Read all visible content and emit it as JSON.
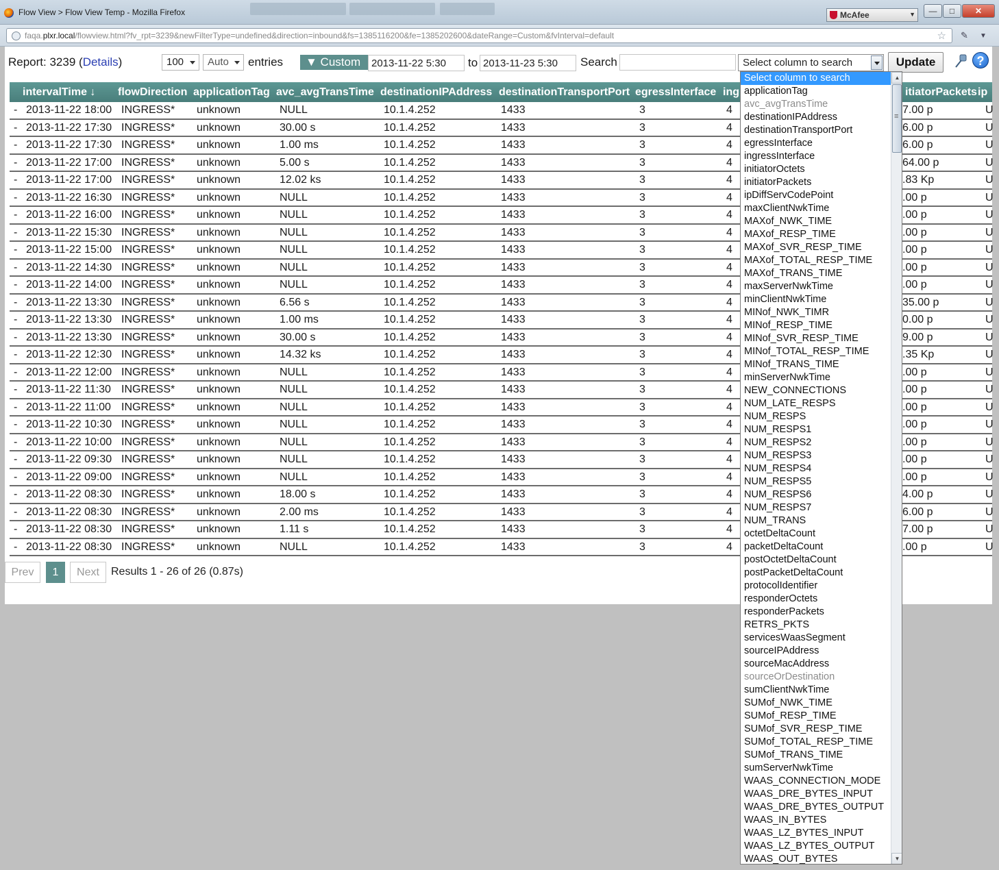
{
  "window": {
    "title": "Flow View > Flow View Temp - Mozilla Firefox",
    "mcafee_label": "McAfee",
    "url_prefix": "faqa.",
    "url_host": "plxr.local",
    "url_rest": "/flowview.html?fv_rpt=3239&newFilterType=undefined&direction=inbound&fs=1385116200&fe=1385202600&dateRange=Custom&fvInterval=default"
  },
  "toolbar": {
    "report_label": "Report: 3239 (",
    "details_link": "Details",
    "report_close": ")",
    "entries_count": "100",
    "interval": "Auto",
    "entries_label": "entries",
    "custom_label": "▼ Custom",
    "date_from": "2013-11-22 5:30",
    "to_label": "to",
    "date_to": "2013-11-23 5:30",
    "search_label": "Search",
    "search_value": "",
    "column_select": "Select column to search",
    "update_label": "Update",
    "help_label": "?"
  },
  "table": {
    "headers": [
      "intervalTime ↓",
      "flowDirection",
      "applicationTag",
      "avc_avgTransTime",
      "destinationIPAddress",
      "destinationTransportPort",
      "egressInterface",
      "ing",
      "itiatorPackets",
      "ip"
    ],
    "rows": [
      [
        "-",
        "2013-11-22 18:00",
        "INGRESS*",
        "unknown",
        "NULL",
        "10.1.4.252",
        "1433",
        "3",
        "4",
        "7.00 p",
        "U"
      ],
      [
        "-",
        "2013-11-22 17:30",
        "INGRESS*",
        "unknown",
        "30.00 s",
        "10.1.4.252",
        "1433",
        "3",
        "4",
        "6.00 p",
        "U"
      ],
      [
        "-",
        "2013-11-22 17:30",
        "INGRESS*",
        "unknown",
        "1.00 ms",
        "10.1.4.252",
        "1433",
        "3",
        "4",
        "6.00 p",
        "U"
      ],
      [
        "-",
        "2013-11-22 17:00",
        "INGRESS*",
        "unknown",
        "5.00 s",
        "10.1.4.252",
        "1433",
        "3",
        "4",
        "64.00 p",
        "U"
      ],
      [
        "-",
        "2013-11-22 17:00",
        "INGRESS*",
        "unknown",
        "12.02 ks",
        "10.1.4.252",
        "1433",
        "3",
        "4",
        ".83 Kp",
        "U"
      ],
      [
        "-",
        "2013-11-22 16:30",
        "INGRESS*",
        "unknown",
        "NULL",
        "10.1.4.252",
        "1433",
        "3",
        "4",
        ".00 p",
        "U"
      ],
      [
        "-",
        "2013-11-22 16:00",
        "INGRESS*",
        "unknown",
        "NULL",
        "10.1.4.252",
        "1433",
        "3",
        "4",
        ".00 p",
        "U"
      ],
      [
        "-",
        "2013-11-22 15:30",
        "INGRESS*",
        "unknown",
        "NULL",
        "10.1.4.252",
        "1433",
        "3",
        "4",
        ".00 p",
        "U"
      ],
      [
        "-",
        "2013-11-22 15:00",
        "INGRESS*",
        "unknown",
        "NULL",
        "10.1.4.252",
        "1433",
        "3",
        "4",
        ".00 p",
        "U"
      ],
      [
        "-",
        "2013-11-22 14:30",
        "INGRESS*",
        "unknown",
        "NULL",
        "10.1.4.252",
        "1433",
        "3",
        "4",
        ".00 p",
        "U"
      ],
      [
        "-",
        "2013-11-22 14:00",
        "INGRESS*",
        "unknown",
        "NULL",
        "10.1.4.252",
        "1433",
        "3",
        "4",
        ".00 p",
        "U"
      ],
      [
        "-",
        "2013-11-22 13:30",
        "INGRESS*",
        "unknown",
        "6.56 s",
        "10.1.4.252",
        "1433",
        "3",
        "4",
        "35.00 p",
        "U"
      ],
      [
        "-",
        "2013-11-22 13:30",
        "INGRESS*",
        "unknown",
        "1.00 ms",
        "10.1.4.252",
        "1433",
        "3",
        "4",
        "0.00 p",
        "U"
      ],
      [
        "-",
        "2013-11-22 13:30",
        "INGRESS*",
        "unknown",
        "30.00 s",
        "10.1.4.252",
        "1433",
        "3",
        "4",
        "9.00 p",
        "U"
      ],
      [
        "-",
        "2013-11-22 12:30",
        "INGRESS*",
        "unknown",
        "14.32 ks",
        "10.1.4.252",
        "1433",
        "3",
        "4",
        ".35 Kp",
        "U"
      ],
      [
        "-",
        "2013-11-22 12:00",
        "INGRESS*",
        "unknown",
        "NULL",
        "10.1.4.252",
        "1433",
        "3",
        "4",
        ".00 p",
        "U"
      ],
      [
        "-",
        "2013-11-22 11:30",
        "INGRESS*",
        "unknown",
        "NULL",
        "10.1.4.252",
        "1433",
        "3",
        "4",
        ".00 p",
        "U"
      ],
      [
        "-",
        "2013-11-22 11:00",
        "INGRESS*",
        "unknown",
        "NULL",
        "10.1.4.252",
        "1433",
        "3",
        "4",
        ".00 p",
        "U"
      ],
      [
        "-",
        "2013-11-22 10:30",
        "INGRESS*",
        "unknown",
        "NULL",
        "10.1.4.252",
        "1433",
        "3",
        "4",
        ".00 p",
        "U"
      ],
      [
        "-",
        "2013-11-22 10:00",
        "INGRESS*",
        "unknown",
        "NULL",
        "10.1.4.252",
        "1433",
        "3",
        "4",
        ".00 p",
        "U"
      ],
      [
        "-",
        "2013-11-22 09:30",
        "INGRESS*",
        "unknown",
        "NULL",
        "10.1.4.252",
        "1433",
        "3",
        "4",
        ".00 p",
        "U"
      ],
      [
        "-",
        "2013-11-22 09:00",
        "INGRESS*",
        "unknown",
        "NULL",
        "10.1.4.252",
        "1433",
        "3",
        "4",
        ".00 p",
        "U"
      ],
      [
        "-",
        "2013-11-22 08:30",
        "INGRESS*",
        "unknown",
        "18.00 s",
        "10.1.4.252",
        "1433",
        "3",
        "4",
        "4.00 p",
        "U"
      ],
      [
        "-",
        "2013-11-22 08:30",
        "INGRESS*",
        "unknown",
        "2.00 ms",
        "10.1.4.252",
        "1433",
        "3",
        "4",
        "6.00 p",
        "U"
      ],
      [
        "-",
        "2013-11-22 08:30",
        "INGRESS*",
        "unknown",
        "1.11 s",
        "10.1.4.252",
        "1433",
        "3",
        "4",
        "7.00 p",
        "U"
      ],
      [
        "-",
        "2013-11-22 08:30",
        "INGRESS*",
        "unknown",
        "NULL",
        "10.1.4.252",
        "1433",
        "3",
        "4",
        ".00 p",
        "U"
      ]
    ]
  },
  "pagination": {
    "prev": "Prev",
    "current": "1",
    "next": "Next",
    "results": "Results 1 - 26 of 26 (0.87s)"
  },
  "column_dropdown": {
    "options": [
      {
        "label": "Select column to search",
        "state": "selected"
      },
      {
        "label": "applicationTag",
        "state": "normal"
      },
      {
        "label": "avc_avgTransTime",
        "state": "disabled"
      },
      {
        "label": "destinationIPAddress",
        "state": "normal"
      },
      {
        "label": "destinationTransportPort",
        "state": "normal"
      },
      {
        "label": "egressInterface",
        "state": "normal"
      },
      {
        "label": "ingressInterface",
        "state": "normal"
      },
      {
        "label": "initiatorOctets",
        "state": "normal"
      },
      {
        "label": "initiatorPackets",
        "state": "normal"
      },
      {
        "label": "ipDiffServCodePoint",
        "state": "normal"
      },
      {
        "label": "maxClientNwkTime",
        "state": "normal"
      },
      {
        "label": "MAXof_NWK_TIME",
        "state": "normal"
      },
      {
        "label": "MAXof_RESP_TIME",
        "state": "normal"
      },
      {
        "label": "MAXof_SVR_RESP_TIME",
        "state": "normal"
      },
      {
        "label": "MAXof_TOTAL_RESP_TIME",
        "state": "normal"
      },
      {
        "label": "MAXof_TRANS_TIME",
        "state": "normal"
      },
      {
        "label": "maxServerNwkTime",
        "state": "normal"
      },
      {
        "label": "minClientNwkTime",
        "state": "normal"
      },
      {
        "label": "MINof_NWK_TIMR",
        "state": "normal"
      },
      {
        "label": "MINof_RESP_TIME",
        "state": "normal"
      },
      {
        "label": "MINof_SVR_RESP_TIME",
        "state": "normal"
      },
      {
        "label": "MINof_TOTAL_RESP_TIME",
        "state": "normal"
      },
      {
        "label": "MINof_TRANS_TIME",
        "state": "normal"
      },
      {
        "label": "minServerNwkTime",
        "state": "normal"
      },
      {
        "label": "NEW_CONNECTIONS",
        "state": "normal"
      },
      {
        "label": "NUM_LATE_RESPS",
        "state": "normal"
      },
      {
        "label": "NUM_RESPS",
        "state": "normal"
      },
      {
        "label": "NUM_RESPS1",
        "state": "normal"
      },
      {
        "label": "NUM_RESPS2",
        "state": "normal"
      },
      {
        "label": "NUM_RESPS3",
        "state": "normal"
      },
      {
        "label": "NUM_RESPS4",
        "state": "normal"
      },
      {
        "label": "NUM_RESPS5",
        "state": "normal"
      },
      {
        "label": "NUM_RESPS6",
        "state": "normal"
      },
      {
        "label": "NUM_RESPS7",
        "state": "normal"
      },
      {
        "label": "NUM_TRANS",
        "state": "normal"
      },
      {
        "label": "octetDeltaCount",
        "state": "normal"
      },
      {
        "label": "packetDeltaCount",
        "state": "normal"
      },
      {
        "label": "postOctetDeltaCount",
        "state": "normal"
      },
      {
        "label": "postPacketDeltaCount",
        "state": "normal"
      },
      {
        "label": "protocolIdentifier",
        "state": "normal"
      },
      {
        "label": "responderOctets",
        "state": "normal"
      },
      {
        "label": "responderPackets",
        "state": "normal"
      },
      {
        "label": "RETRS_PKTS",
        "state": "normal"
      },
      {
        "label": "servicesWaasSegment",
        "state": "normal"
      },
      {
        "label": "sourceIPAddress",
        "state": "normal"
      },
      {
        "label": "sourceMacAddress",
        "state": "normal"
      },
      {
        "label": "sourceOrDestination",
        "state": "disabled"
      },
      {
        "label": "sumClientNwkTime",
        "state": "normal"
      },
      {
        "label": "SUMof_NWK_TIME",
        "state": "normal"
      },
      {
        "label": "SUMof_RESP_TIME",
        "state": "normal"
      },
      {
        "label": "SUMof_SVR_RESP_TIME",
        "state": "normal"
      },
      {
        "label": "SUMof_TOTAL_RESP_TIME",
        "state": "normal"
      },
      {
        "label": "SUMof_TRANS_TIME",
        "state": "normal"
      },
      {
        "label": "sumServerNwkTime",
        "state": "normal"
      },
      {
        "label": "WAAS_CONNECTION_MODE",
        "state": "normal"
      },
      {
        "label": "WAAS_DRE_BYTES_INPUT",
        "state": "normal"
      },
      {
        "label": "WAAS_DRE_BYTES_OUTPUT",
        "state": "normal"
      },
      {
        "label": "WAAS_IN_BYTES",
        "state": "normal"
      },
      {
        "label": "WAAS_LZ_BYTES_INPUT",
        "state": "normal"
      },
      {
        "label": "WAAS_LZ_BYTES_OUTPUT",
        "state": "normal"
      },
      {
        "label": "WAAS_OUT_BYTES",
        "state": "normal"
      }
    ]
  },
  "colors": {
    "header_teal": "#5d9894",
    "custom_button": "#5d8f8d",
    "selected_option": "#3399ff",
    "link_blue": "#2b3fb3"
  }
}
